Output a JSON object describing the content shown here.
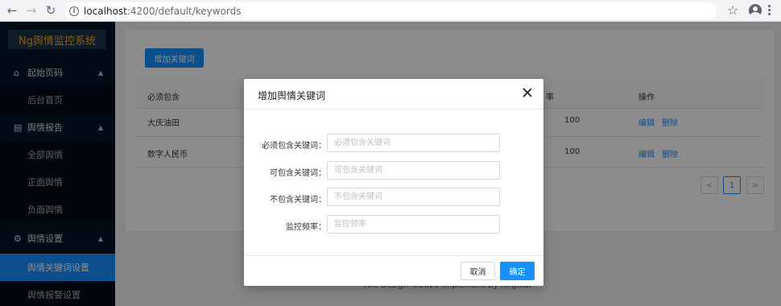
{
  "browser": {
    "url_host": "localhost",
    "url_path": ":4200/default/keywords",
    "back_icon": "arrow-left",
    "forward_icon": "arrow-right",
    "reload_icon": "reload"
  },
  "sidebar": {
    "logo": "Ng舆情监控系统",
    "groups": [
      {
        "label": "起始页码",
        "icon": "home-icon",
        "items": [
          {
            "label": "后台首页"
          }
        ]
      },
      {
        "label": "舆情报告",
        "icon": "chart-icon",
        "items": [
          {
            "label": "全部舆情"
          },
          {
            "label": "正面舆情"
          },
          {
            "label": "负面舆情"
          }
        ]
      },
      {
        "label": "舆情设置",
        "icon": "settings-icon",
        "items": [
          {
            "label": "舆情关键词设置",
            "active": true
          },
          {
            "label": "舆情报警设置"
          }
        ]
      }
    ]
  },
  "main": {
    "add_button": "增加关键词",
    "table": {
      "headers": [
        "必须包含",
        "率",
        "操作"
      ],
      "rows": [
        {
          "must": "大庆油田",
          "rate": "100",
          "edit": "编辑",
          "delete": "删除"
        },
        {
          "must": "数字人民币",
          "rate": "100",
          "edit": "编辑",
          "delete": "删除"
        }
      ]
    },
    "pagination": {
      "prev": "<",
      "current": "1",
      "next": ">"
    },
    "footer": "Ant Design ©2020 Implement By Angular"
  },
  "modal": {
    "title": "增加舆情关键词",
    "fields": [
      {
        "label": "必须包含关键词：",
        "placeholder": "必须包含关键词"
      },
      {
        "label": "可包含关键词：",
        "placeholder": "可包含关键词"
      },
      {
        "label": "不包含关键词：",
        "placeholder": "不包含关键词"
      },
      {
        "label": "监控频率：",
        "placeholder": "监控频率"
      }
    ],
    "cancel": "取消",
    "ok": "确定"
  }
}
